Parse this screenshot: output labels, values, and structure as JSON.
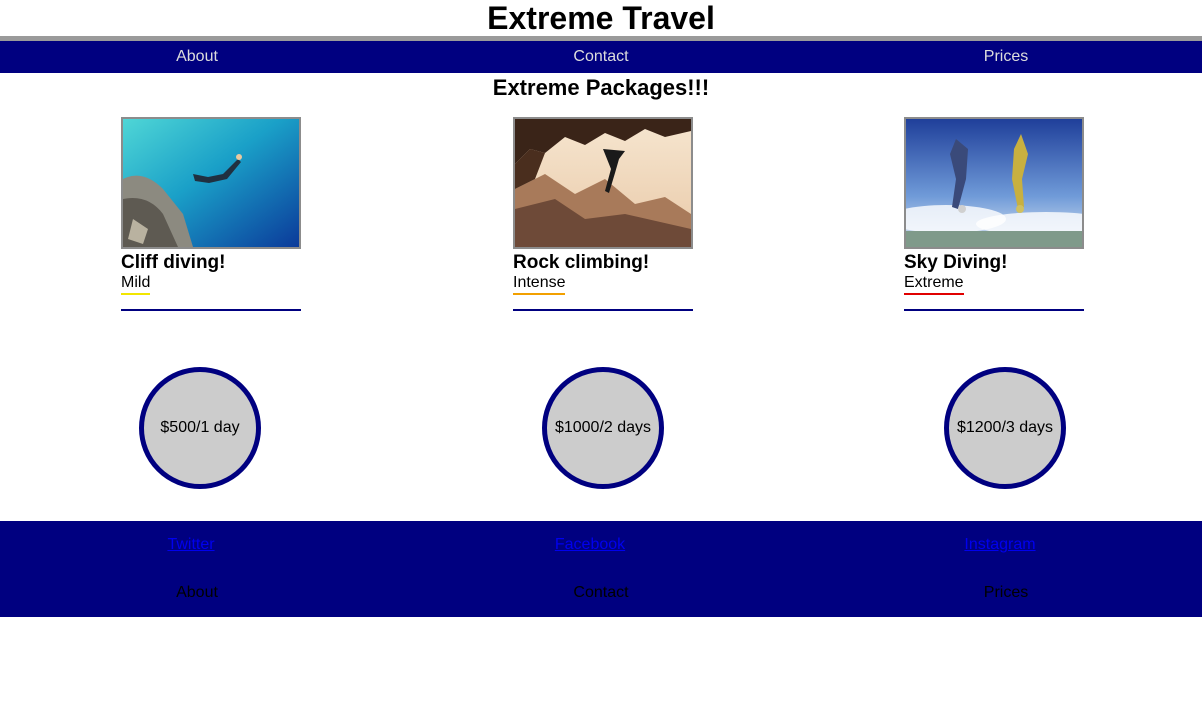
{
  "site": {
    "title": "Extreme Travel"
  },
  "nav": {
    "items": [
      {
        "label": "About"
      },
      {
        "label": "Contact"
      },
      {
        "label": "Prices"
      }
    ]
  },
  "packages": {
    "heading": "Extreme Packages!!!",
    "items": [
      {
        "name": "Cliff diving!",
        "level": "Mild",
        "level_color": "#f2e600",
        "price": "$500/1 day"
      },
      {
        "name": "Rock climbing!",
        "level": "Intense",
        "level_color": "#f2a000",
        "price": "$1000/2 days"
      },
      {
        "name": "Sky Diving!",
        "level": "Extreme",
        "level_color": "#e00000",
        "price": "$1200/3 days"
      }
    ]
  },
  "footer": {
    "social": [
      {
        "label": "Twitter"
      },
      {
        "label": "Facebook"
      },
      {
        "label": "Instagram"
      }
    ],
    "nav": [
      {
        "label": "About"
      },
      {
        "label": "Contact"
      },
      {
        "label": "Prices"
      }
    ]
  },
  "colors": {
    "nav_bg": "#000080",
    "title_rule": "#9a9a9a",
    "circle_bg": "#cccccc",
    "link": "#0000ee"
  }
}
